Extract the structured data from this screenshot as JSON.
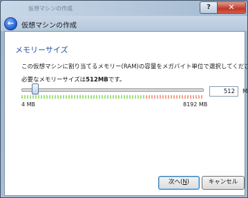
{
  "window": {
    "background_title": "仮想マシンの作成",
    "help_glyph": "?",
    "close_glyph": "✕",
    "title": "仮想マシンの作成"
  },
  "nav": {
    "back_glyph": "←"
  },
  "content": {
    "section_title": "メモリーサイズ",
    "description": "この仮想マシンに割り当てるメモリー(RAM)の容量をメガバイト単位で選択してください。",
    "requirement_prefix": "必要なメモリーサイズは",
    "requirement_value": "512MB",
    "requirement_suffix": "です。",
    "slider": {
      "min_label": "4 MB",
      "max_label": "8192 MB",
      "value_mb": 512,
      "value_fraction": 0.062
    },
    "memory_field_value": "512",
    "memory_unit": "MB"
  },
  "buttons": {
    "next_prefix": "次へ(",
    "next_access": "N",
    "next_suffix": ")",
    "cancel": "キャンセル"
  },
  "colors": {
    "accent_title": "#1f4f9c",
    "tick_green": "#9fe07a",
    "tick_red": "#f2a38d"
  }
}
